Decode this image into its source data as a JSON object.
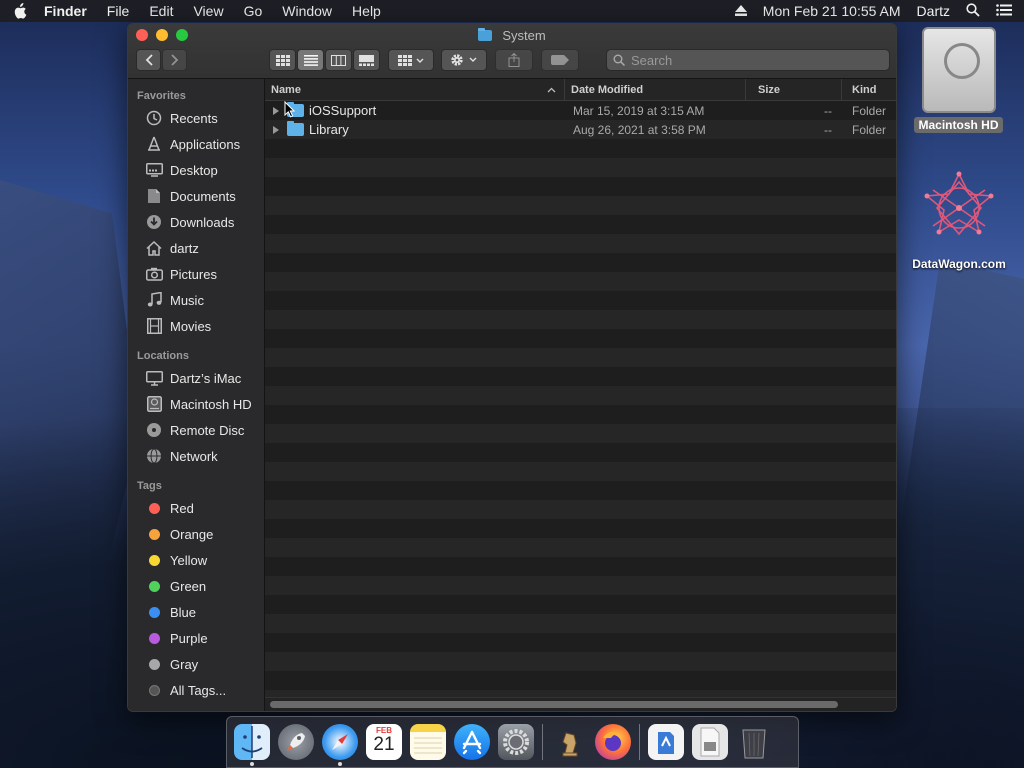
{
  "menubar": {
    "app": "Finder",
    "items": [
      "File",
      "Edit",
      "View",
      "Go",
      "Window",
      "Help"
    ],
    "datetime": "Mon Feb 21  10:55 AM",
    "user": "Dartz"
  },
  "window": {
    "title": "System",
    "search_placeholder": "Search"
  },
  "sidebar": {
    "favorites_header": "Favorites",
    "favorites": [
      {
        "label": "Recents"
      },
      {
        "label": "Applications"
      },
      {
        "label": "Desktop"
      },
      {
        "label": "Documents"
      },
      {
        "label": "Downloads"
      },
      {
        "label": "dartz"
      },
      {
        "label": "Pictures"
      },
      {
        "label": "Music"
      },
      {
        "label": "Movies"
      }
    ],
    "locations_header": "Locations",
    "locations": [
      {
        "label": "Dartz’s iMac"
      },
      {
        "label": "Macintosh HD"
      },
      {
        "label": "Remote Disc"
      },
      {
        "label": "Network"
      }
    ],
    "tags_header": "Tags",
    "tags": [
      {
        "label": "Red",
        "color": "#fe5f57"
      },
      {
        "label": "Orange",
        "color": "#f6a33b"
      },
      {
        "label": "Yellow",
        "color": "#f7d732"
      },
      {
        "label": "Green",
        "color": "#4fd15c"
      },
      {
        "label": "Blue",
        "color": "#3a8ff3"
      },
      {
        "label": "Purple",
        "color": "#b95be0"
      },
      {
        "label": "Gray",
        "color": "#a7a7a7"
      },
      {
        "label": "All Tags...",
        "color": "#555555"
      }
    ]
  },
  "table": {
    "columns": [
      "Name",
      "Date Modified",
      "Size",
      "Kind"
    ],
    "rows": [
      {
        "name": "iOSSupport",
        "date": "Mar 15, 2019 at 3:15 AM",
        "size": "--",
        "kind": "Folder"
      },
      {
        "name": "Library",
        "date": "Aug 26, 2021 at 3:58 PM",
        "size": "--",
        "kind": "Folder"
      }
    ]
  },
  "desktop": {
    "hd_label": "Macintosh HD",
    "dw_label": "DataWagon.com"
  },
  "calendar": {
    "month": "FEB",
    "day": "21"
  }
}
